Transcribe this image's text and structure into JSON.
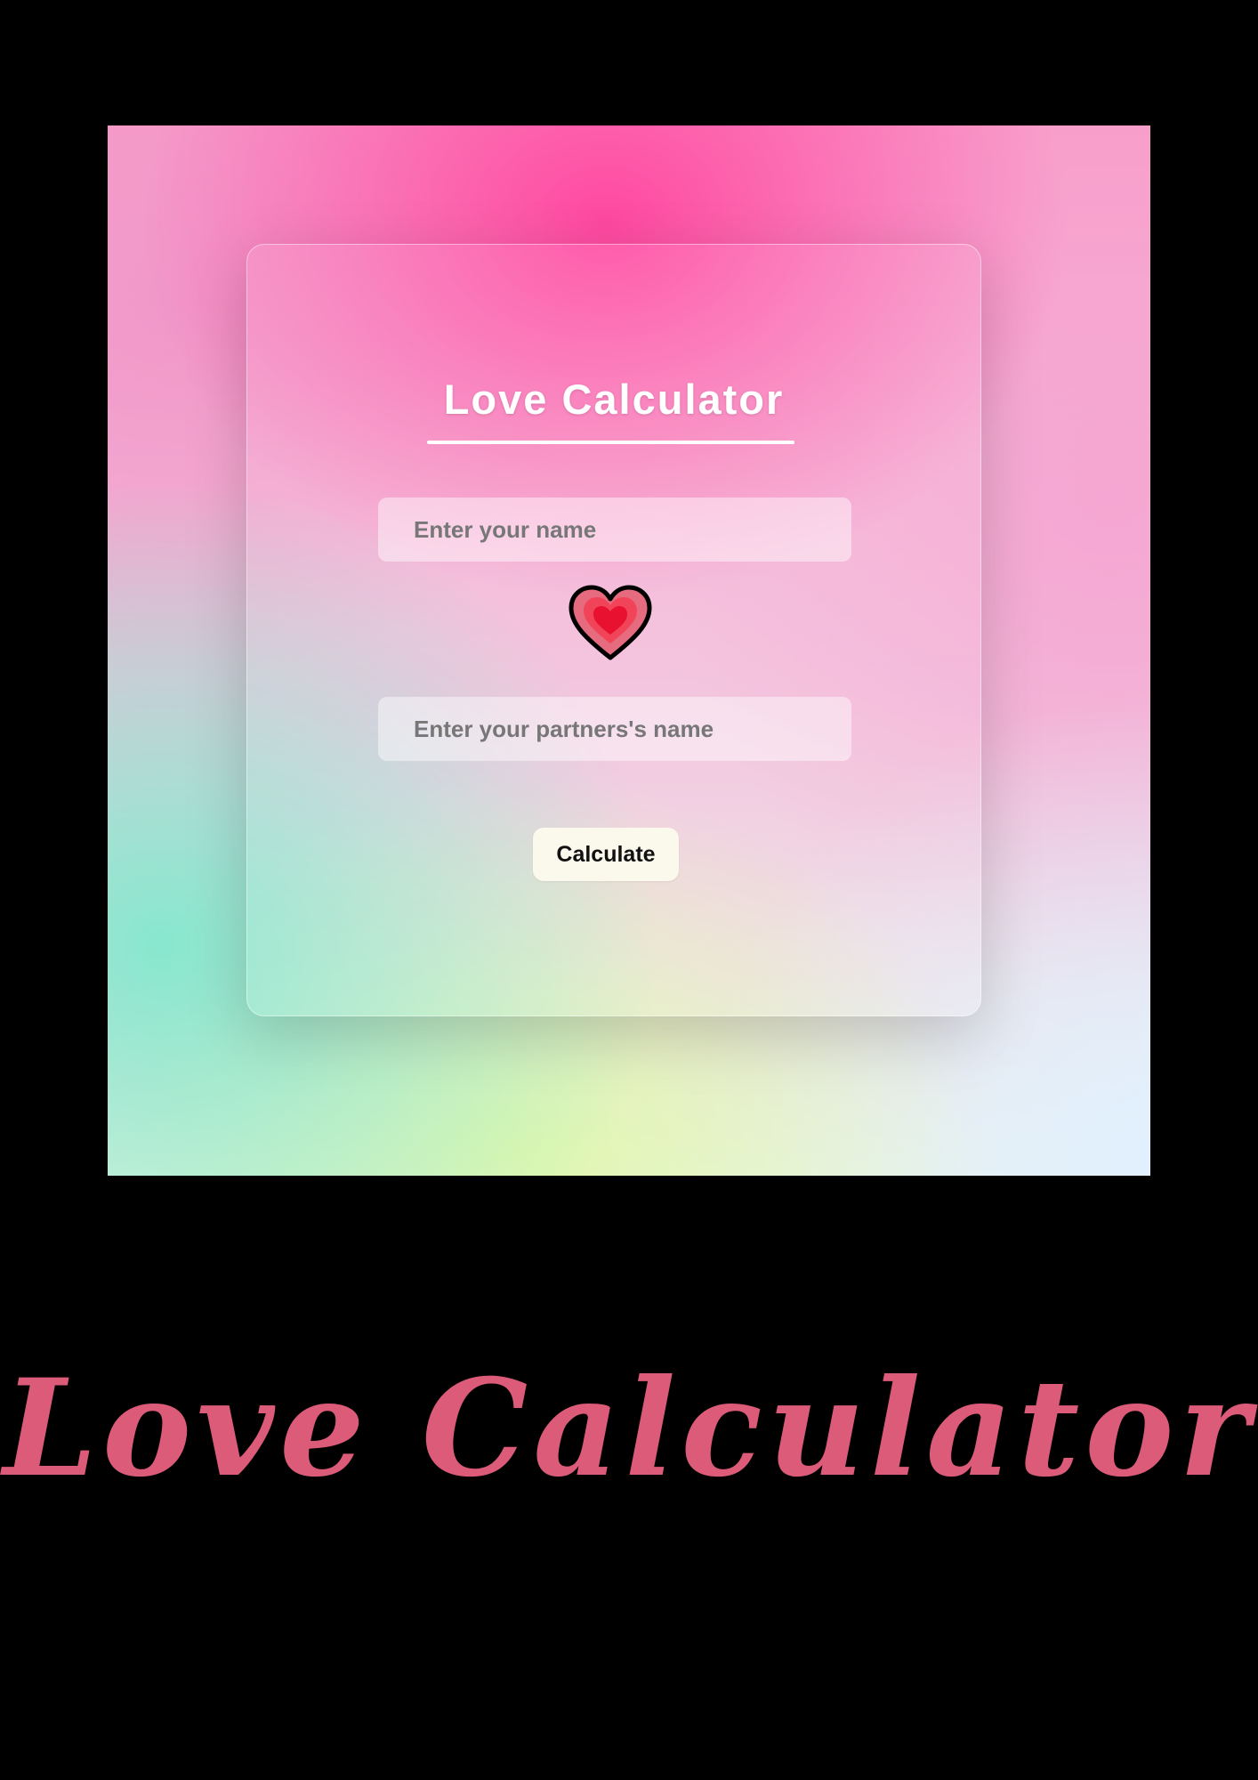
{
  "app": {
    "title": "Love Calculator",
    "accent_color": "#ff4fa3"
  },
  "form": {
    "name_placeholder": "Enter your name",
    "name_value": "",
    "partner_placeholder": "Enter your partners's name",
    "partner_value": "",
    "heart_icon": "growing-heart-icon",
    "calculate_label": "Calculate"
  },
  "caption": {
    "text": "Love Calculator",
    "color": "#dc5b78"
  }
}
